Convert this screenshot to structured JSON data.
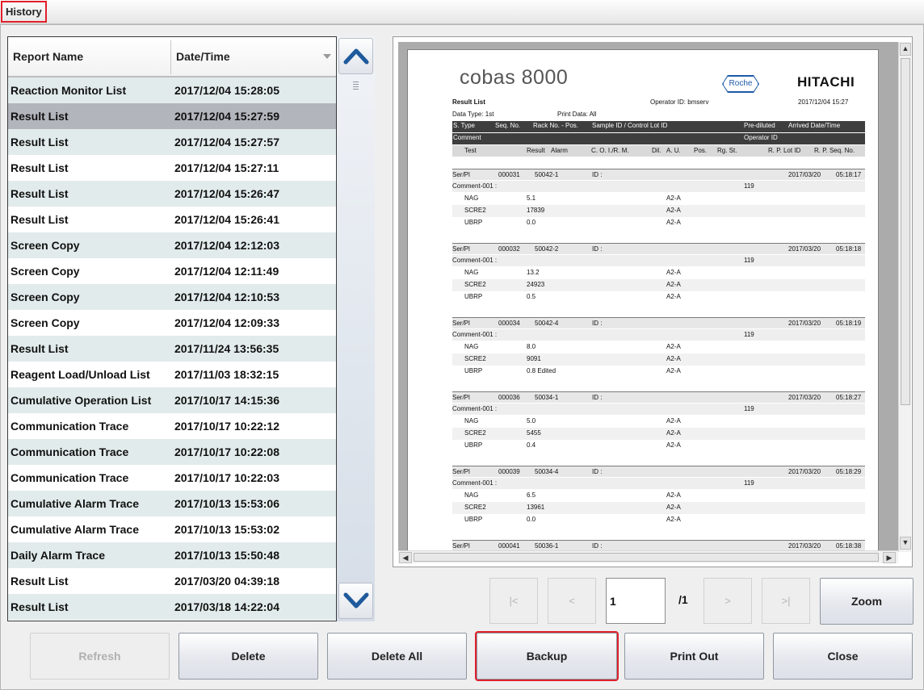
{
  "window": {
    "title": "History"
  },
  "list": {
    "col_report_name": "Report Name",
    "col_date_time": "Date/Time",
    "rows": [
      {
        "name": "Reaction Monitor List",
        "date": "2017/12/04 15:28:05"
      },
      {
        "name": "Result List",
        "date": "2017/12/04 15:27:59"
      },
      {
        "name": "Result List",
        "date": "2017/12/04 15:27:57"
      },
      {
        "name": "Result List",
        "date": "2017/12/04 15:27:11"
      },
      {
        "name": "Result List",
        "date": "2017/12/04 15:26:47"
      },
      {
        "name": "Result List",
        "date": "2017/12/04 15:26:41"
      },
      {
        "name": "Screen Copy",
        "date": "2017/12/04 12:12:03"
      },
      {
        "name": "Screen Copy",
        "date": "2017/12/04 12:11:49"
      },
      {
        "name": "Screen Copy",
        "date": "2017/12/04 12:10:53"
      },
      {
        "name": "Screen Copy",
        "date": "2017/12/04 12:09:33"
      },
      {
        "name": "Result List",
        "date": "2017/11/24 13:56:35"
      },
      {
        "name": "Reagent Load/Unload List",
        "date": "2017/11/03 18:32:15"
      },
      {
        "name": "Cumulative Operation List",
        "date": "2017/10/17 14:15:36"
      },
      {
        "name": "Communication Trace",
        "date": "2017/10/17 10:22:12"
      },
      {
        "name": "Communication Trace",
        "date": "2017/10/17 10:22:08"
      },
      {
        "name": "Communication Trace",
        "date": "2017/10/17 10:22:03"
      },
      {
        "name": "Cumulative Alarm Trace",
        "date": "2017/10/13 15:53:06"
      },
      {
        "name": "Cumulative Alarm Trace",
        "date": "2017/10/13 15:53:02"
      },
      {
        "name": "Daily Alarm Trace",
        "date": "2017/10/13 15:50:48"
      },
      {
        "name": "Result List",
        "date": "2017/03/20 04:39:18"
      },
      {
        "name": "Result List",
        "date": "2017/03/18 14:22:04"
      }
    ]
  },
  "report": {
    "logo_text": "cobas 8000",
    "roche": "Roche",
    "hitachi": "HITACHI",
    "title": "Result List",
    "operator": "Operator ID: bmserv",
    "printed": "2017/12/04 15:27",
    "data_type": "Data Type:  1st",
    "print_data": "Print Data:   All",
    "h1": {
      "s_type": "S. Type",
      "seq": "Seq. No.",
      "rack": "Rack No. - Pos.",
      "sample": "Sample ID / Control Lot ID",
      "prediluted": "Pre-diluted",
      "arrived": "Arrived Date/Time"
    },
    "h2": {
      "comment": "Comment",
      "operator": "Operator ID"
    },
    "h3": {
      "test": "Test",
      "result": "Result",
      "alarm": "Alarm",
      "coi": "C. O. I./R. M.",
      "dil": "Dil.",
      "au": "A. U.",
      "pos": "Pos.",
      "rg": "Rg. St.",
      "rp_lot": "R. P. Lot ID",
      "rp_seq": "R. P. Seq. No."
    },
    "samples": [
      {
        "type": "Ser/Pl",
        "seq": "000031",
        "rack": "50042-1",
        "id": "ID :",
        "date": "2017/03/20",
        "time": "05:18:17",
        "comment": "Comment-001 :",
        "op": "119",
        "tests": [
          {
            "test": "NAG",
            "result": "5.1",
            "au": "A2-A"
          },
          {
            "test": "SCRE2",
            "result": "17839",
            "au": "A2-A"
          },
          {
            "test": "UBRP",
            "result": "0.0",
            "au": "A2-A"
          }
        ]
      },
      {
        "type": "Ser/Pl",
        "seq": "000032",
        "rack": "50042-2",
        "id": "ID :",
        "date": "2017/03/20",
        "time": "05:18:18",
        "comment": "Comment-001 :",
        "op": "119",
        "tests": [
          {
            "test": "NAG",
            "result": "13.2",
            "au": "A2-A"
          },
          {
            "test": "SCRE2",
            "result": "24923",
            "au": "A2-A"
          },
          {
            "test": "UBRP",
            "result": "0.5",
            "au": "A2-A"
          }
        ]
      },
      {
        "type": "Ser/Pl",
        "seq": "000034",
        "rack": "50042-4",
        "id": "ID :",
        "date": "2017/03/20",
        "time": "05:18:19",
        "comment": "Comment-001 :",
        "op": "119",
        "tests": [
          {
            "test": "NAG",
            "result": "8.0",
            "au": "A2-A"
          },
          {
            "test": "SCRE2",
            "result": "9091",
            "au": "A2-A"
          },
          {
            "test": "UBRP",
            "result": "0.8 Edited",
            "au": "A2-A"
          }
        ]
      },
      {
        "type": "Ser/Pl",
        "seq": "000036",
        "rack": "50034-1",
        "id": "ID :",
        "date": "2017/03/20",
        "time": "05:18:27",
        "comment": "Comment-001 :",
        "op": "119",
        "tests": [
          {
            "test": "NAG",
            "result": "5.0",
            "au": "A2-A"
          },
          {
            "test": "SCRE2",
            "result": "5455",
            "au": "A2-A"
          },
          {
            "test": "UBRP",
            "result": "0.4",
            "au": "A2-A"
          }
        ]
      },
      {
        "type": "Ser/Pl",
        "seq": "000039",
        "rack": "50034-4",
        "id": "ID :",
        "date": "2017/03/20",
        "time": "05:18:29",
        "comment": "Comment-001 :",
        "op": "119",
        "tests": [
          {
            "test": "NAG",
            "result": "6.5",
            "au": "A2-A"
          },
          {
            "test": "SCRE2",
            "result": "13961",
            "au": "A2-A"
          },
          {
            "test": "UBRP",
            "result": "0.0",
            "au": "A2-A"
          }
        ]
      },
      {
        "type": "Ser/Pl",
        "seq": "000041",
        "rack": "50036-1",
        "id": "ID :",
        "date": "2017/03/20",
        "time": "05:18:38",
        "comment": "",
        "op": "",
        "tests": []
      }
    ]
  },
  "nav": {
    "first": "|<",
    "prev": "<",
    "page": "1",
    "total": "/1",
    "next": ">",
    "last": ">|",
    "zoom": "Zoom"
  },
  "buttons": {
    "refresh": "Refresh",
    "delete": "Delete",
    "delete_all": "Delete All",
    "backup": "Backup",
    "print_out": "Print Out",
    "close": "Close"
  }
}
